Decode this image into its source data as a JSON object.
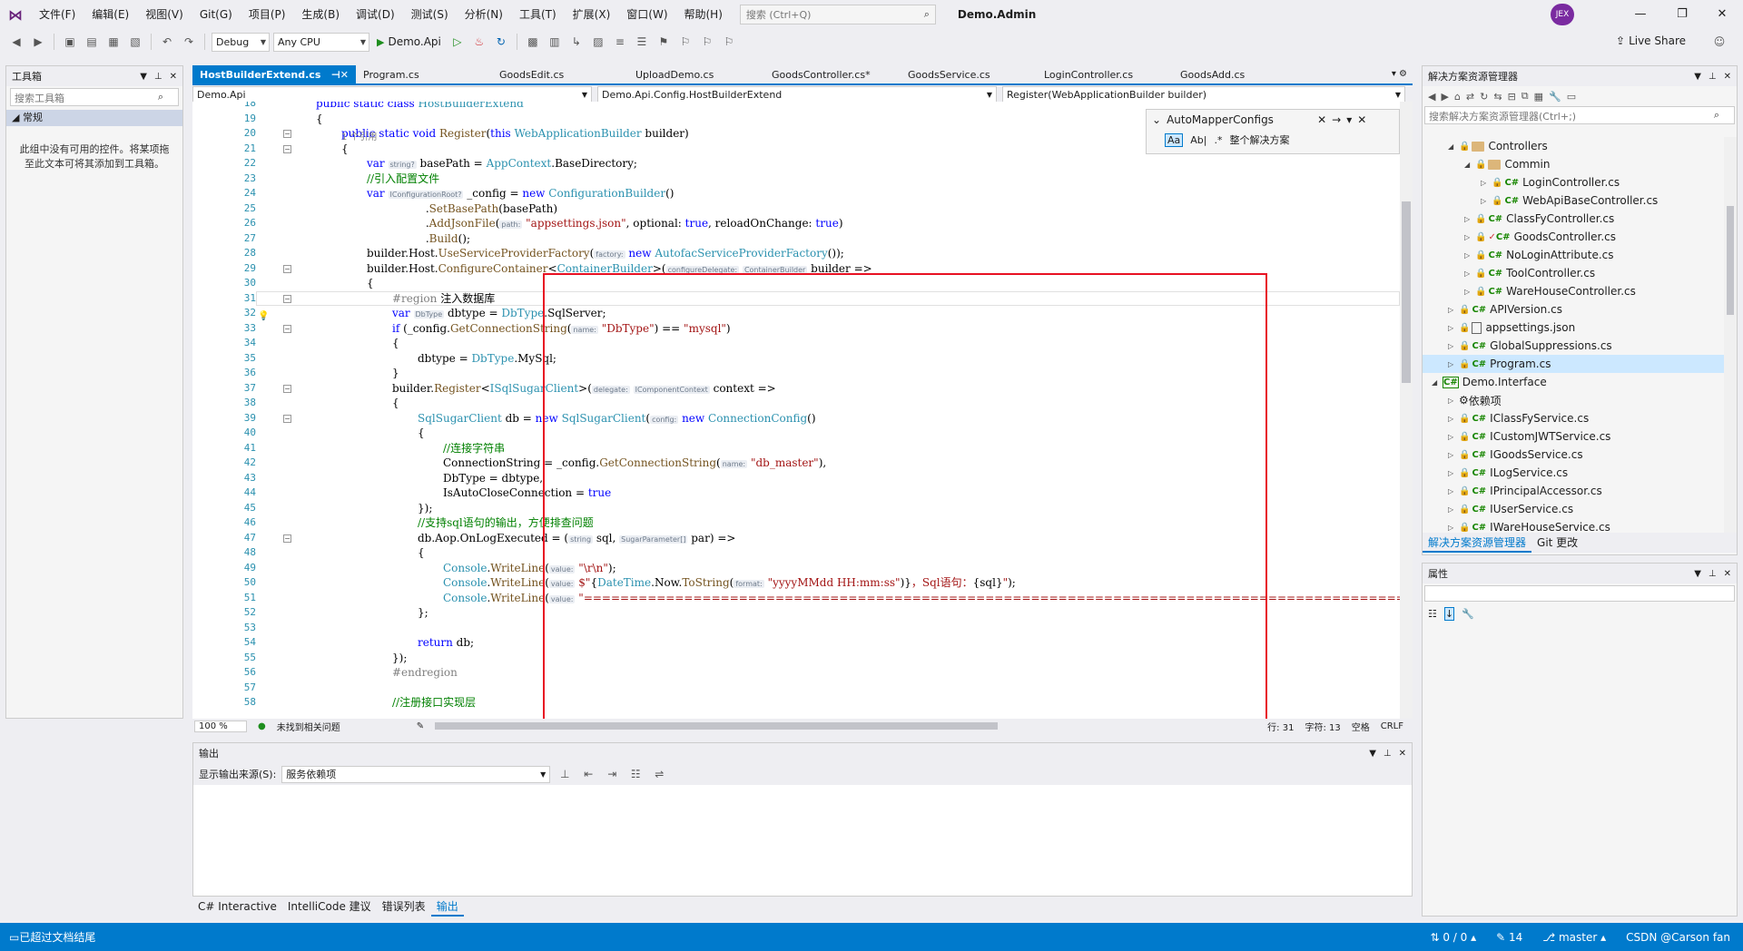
{
  "menubar": {
    "items": [
      "文件(F)",
      "编辑(E)",
      "视图(V)",
      "Git(G)",
      "项目(P)",
      "生成(B)",
      "调试(D)",
      "测试(S)",
      "分析(N)",
      "工具(T)",
      "扩展(X)",
      "窗口(W)",
      "帮助(H)"
    ],
    "search_placeholder": "搜索 (Ctrl+Q)",
    "window_title": "Demo.Admin",
    "live_share": "Live Share",
    "avatar": "JEX"
  },
  "toolbar": {
    "config": "Debug",
    "platform": "Any CPU",
    "run_target": "Demo.Api"
  },
  "toolbox": {
    "title": "工具箱",
    "search_placeholder": "搜索工具箱",
    "group": "常规",
    "empty_text": "此组中没有可用的控件。将某项拖至此文本可将其添加到工具箱。"
  },
  "tabs": [
    "HostBuilderExtend.cs",
    "Program.cs",
    "GoodsEdit.cs",
    "UploadDemo.cs",
    "GoodsController.cs*",
    "GoodsService.cs",
    "LoginController.cs",
    "GoodsAdd.cs"
  ],
  "nav": {
    "project": "Demo.Api",
    "type": "Demo.Api.Config.HostBuilderExtend",
    "member": "Register(WebApplicationBuilder builder)"
  },
  "findbox": {
    "query": "AutoMapperConfigs",
    "scope": "整个解决方案",
    "aa": "Aa",
    "ab": "Ab|"
  },
  "code_refcount": "1 个引用",
  "editor_status": {
    "zoom": "100 %",
    "issues": "未找到相关问题",
    "line": "行: 31",
    "char": "字符: 13",
    "ws": "空格",
    "eol": "CRLF"
  },
  "output": {
    "title": "输出",
    "source_label": "显示输出来源(S):",
    "source_value": "服务依赖项"
  },
  "bottom_tabs": [
    "C# Interactive",
    "IntelliCode 建议",
    "错误列表",
    "输出"
  ],
  "solution": {
    "title": "解决方案资源管理器",
    "search_placeholder": "搜索解决方案资源管理器(Ctrl+;)",
    "items": [
      {
        "label": "Controllers",
        "kind": "folder",
        "indent": 1,
        "open": true
      },
      {
        "label": "Commin",
        "kind": "folder",
        "indent": 2,
        "open": true
      },
      {
        "label": "LoginController.cs",
        "kind": "cs",
        "indent": 3
      },
      {
        "label": "WebApiBaseController.cs",
        "kind": "cs",
        "indent": 3
      },
      {
        "label": "ClassFyController.cs",
        "kind": "cs",
        "indent": 2
      },
      {
        "label": "GoodsController.cs",
        "kind": "cs",
        "indent": 2,
        "check": true
      },
      {
        "label": "NoLoginAttribute.cs",
        "kind": "cs",
        "indent": 2
      },
      {
        "label": "ToolController.cs",
        "kind": "cs",
        "indent": 2
      },
      {
        "label": "WareHouseController.cs",
        "kind": "cs",
        "indent": 2
      },
      {
        "label": "APIVersion.cs",
        "kind": "cs",
        "indent": 1
      },
      {
        "label": "appsettings.json",
        "kind": "json",
        "indent": 1
      },
      {
        "label": "GlobalSuppressions.cs",
        "kind": "cs",
        "indent": 1
      },
      {
        "label": "Program.cs",
        "kind": "cs",
        "indent": 1,
        "selected": true
      },
      {
        "label": "Demo.Interface",
        "kind": "proj",
        "indent": 0,
        "open": true
      },
      {
        "label": "依赖项",
        "kind": "dep",
        "indent": 1
      },
      {
        "label": "IClassFyService.cs",
        "kind": "cs",
        "indent": 1
      },
      {
        "label": "ICustomJWTService.cs",
        "kind": "cs",
        "indent": 1
      },
      {
        "label": "IGoodsService.cs",
        "kind": "cs",
        "indent": 1
      },
      {
        "label": "ILogService.cs",
        "kind": "cs",
        "indent": 1
      },
      {
        "label": "IPrincipalAccessor.cs",
        "kind": "cs",
        "indent": 1
      },
      {
        "label": "IUserService.cs",
        "kind": "cs",
        "indent": 1
      },
      {
        "label": "IWareHouseService.cs",
        "kind": "cs",
        "indent": 1
      }
    ],
    "tabs": [
      "解决方案资源管理器",
      "Git 更改"
    ]
  },
  "properties": {
    "title": "属性"
  },
  "statusbar": {
    "left": "已超过文档结尾",
    "sync": "0 / 0",
    "edits": "14",
    "branch": "master",
    "watermark": "CSDN @Carson fan"
  },
  "code_lines": [
    {
      "n": "18",
      "html": "<span class='kw'>public static class</span> <span class='ty'>HostBuilderExtend</span>",
      "i": 0
    },
    {
      "n": "19",
      "html": "{",
      "i": 0
    },
    {
      "n": "20",
      "html": "<span class='kw'>public static void</span> <span class='mt'>Register</span>(<span class='kw'>this</span> <span class='ty'>WebApplicationBuilder</span> builder)",
      "i": 1
    },
    {
      "n": "21",
      "html": "{",
      "i": 1
    },
    {
      "n": "22",
      "html": "<span class='kw'>var</span> <span class='hint'>string?</span> basePath = <span class='ty'>AppContext</span>.BaseDirectory;",
      "i": 2
    },
    {
      "n": "23",
      "html": "<span class='cm'>//引入配置文件</span>",
      "i": 2
    },
    {
      "n": "24",
      "html": "<span class='kw'>var</span> <span class='hint'>IConfigurationRoot?</span> _config = <span class='kw'>new</span> <span class='ty'>ConfigurationBuilder</span>()",
      "i": 2
    },
    {
      "n": "25",
      "html": "                 .<span class='mt'>SetBasePath</span>(basePath)",
      "i": 2
    },
    {
      "n": "26",
      "html": "                 .<span class='mt'>AddJsonFile</span>(<span class='hint'>path:</span> <span class='st'>\"appsettings.json\"</span>, optional: <span class='kw'>true</span>, reloadOnChange: <span class='kw'>true</span>)",
      "i": 2
    },
    {
      "n": "27",
      "html": "                 .<span class='mt'>Build</span>();",
      "i": 2
    },
    {
      "n": "28",
      "html": "builder.Host.<span class='mt'>UseServiceProviderFactory</span>(<span class='hint'>factory:</span> <span class='kw'>new</span> <span class='ty'>AutofacServiceProviderFactory</span>());",
      "i": 2
    },
    {
      "n": "29",
      "html": "builder.Host.<span class='mt'>ConfigureContainer</span>&lt;<span class='ty'>ContainerBuilder</span>&gt;(<span class='hint'>configureDelegate:</span> <span class='hint'>ContainerBuilder</span> builder =&gt;",
      "i": 2
    },
    {
      "n": "30",
      "html": "{",
      "i": 2
    },
    {
      "n": "31",
      "html": "<span class='rg'>#region</span> 注入数据库",
      "i": 3
    },
    {
      "n": "32",
      "html": "<span class='kw'>var</span> <span class='hint'>DbType</span> dbtype = <span class='ty'>DbType</span>.SqlServer;",
      "i": 3
    },
    {
      "n": "33",
      "html": "<span class='kw'>if</span> (_config.<span class='mt'>GetConnectionString</span>(<span class='hint'>name:</span> <span class='st'>\"DbType\"</span>) == <span class='st'>\"mysql\"</span>)",
      "i": 3
    },
    {
      "n": "34",
      "html": "{",
      "i": 3
    },
    {
      "n": "35",
      "html": "dbtype = <span class='ty'>DbType</span>.MySql;",
      "i": 4
    },
    {
      "n": "36",
      "html": "}",
      "i": 3
    },
    {
      "n": "37",
      "html": "builder.<span class='mt'>Register</span>&lt;<span class='ty'>ISqlSugarClient</span>&gt;(<span class='hint'>delegate:</span> <span class='hint'>IComponentContext</span> context =&gt;",
      "i": 3
    },
    {
      "n": "38",
      "html": "{",
      "i": 3
    },
    {
      "n": "39",
      "html": "<span class='ty'>SqlSugarClient</span> db = <span class='kw'>new</span> <span class='ty'>SqlSugarClient</span>(<span class='hint'>config:</span> <span class='kw'>new</span> <span class='ty'>ConnectionConfig</span>()",
      "i": 4
    },
    {
      "n": "40",
      "html": "{",
      "i": 4
    },
    {
      "n": "41",
      "html": "<span class='cm'>//连接字符串</span>",
      "i": 5
    },
    {
      "n": "42",
      "html": "ConnectionString = _config.<span class='mt'>GetConnectionString</span>(<span class='hint'>name:</span> <span class='st'>\"db_master\"</span>),",
      "i": 5
    },
    {
      "n": "43",
      "html": "DbType = dbtype,",
      "i": 5
    },
    {
      "n": "44",
      "html": "IsAutoCloseConnection = <span class='kw'>true</span>",
      "i": 5
    },
    {
      "n": "45",
      "html": "});",
      "i": 4
    },
    {
      "n": "46",
      "html": "<span class='cm'>//支持sql语句的输出，方便排查问题</span>",
      "i": 4
    },
    {
      "n": "47",
      "html": "db.Aop.OnLogExecuted = (<span class='hint'>string</span> sql, <span class='hint'>SugarParameter[]</span> par) =&gt;",
      "i": 4
    },
    {
      "n": "48",
      "html": "{",
      "i": 4
    },
    {
      "n": "49",
      "html": "<span class='ty'>Console</span>.<span class='mt'>WriteLine</span>(<span class='hint'>value:</span> <span class='st'>\"\\r\\n\"</span>);",
      "i": 5
    },
    {
      "n": "50",
      "html": "<span class='ty'>Console</span>.<span class='mt'>WriteLine</span>(<span class='hint'>value:</span> <span class='st'>$\"</span>{<span class='ty'>DateTime</span>.Now.<span class='mt'>ToString</span>(<span class='hint'>format:</span> <span class='st'>\"yyyyMMdd HH:mm:ss\"</span>)}<span class='st'>，Sql语句：</span>{sql}<span class='st'>\"</span>);",
      "i": 5
    },
    {
      "n": "51",
      "html": "<span class='ty'>Console</span>.<span class='mt'>WriteLine</span>(<span class='hint'>value:</span> <span class='st'>\"=================================================================================================================\"</span>);",
      "i": 5
    },
    {
      "n": "52",
      "html": "};",
      "i": 4
    },
    {
      "n": "53",
      "html": "",
      "i": 4
    },
    {
      "n": "54",
      "html": "<span class='kw'>return</span> db;",
      "i": 4
    },
    {
      "n": "55",
      "html": "});",
      "i": 3
    },
    {
      "n": "56",
      "html": "<span class='rg'>#endregion</span>",
      "i": 3
    },
    {
      "n": "57",
      "html": "",
      "i": 3
    },
    {
      "n": "58",
      "html": "<span class='cm'>//注册接口实现层</span>",
      "i": 3
    }
  ]
}
